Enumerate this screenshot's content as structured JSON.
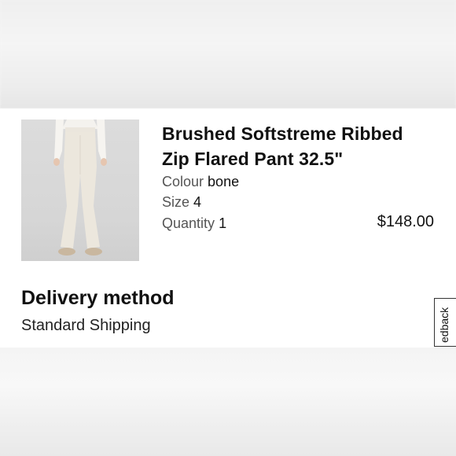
{
  "product": {
    "title": "Brushed Softstreme Ribbed Zip Flared Pant 32.5\"",
    "image": "product-photo",
    "colour_label": "Colour",
    "colour_value": "bone",
    "size_label": "Size",
    "size_value": "4",
    "quantity_label": "Quantity",
    "quantity_value": "1",
    "price": "$148.00"
  },
  "delivery": {
    "heading": "Delivery method",
    "method": "Standard Shipping"
  },
  "feedback": {
    "label": "edback"
  }
}
